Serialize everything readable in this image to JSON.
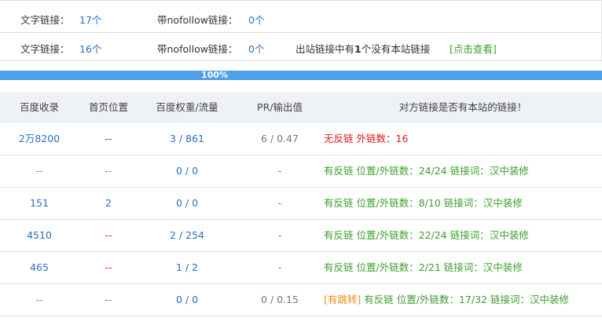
{
  "summary": {
    "row1": {
      "text_label": "文字链接：",
      "text_value": "17个",
      "nofollow_label": "带nofollow链接：",
      "nofollow_value": "0个"
    },
    "row2": {
      "text_label": "文字链接：",
      "text_value": "16个",
      "nofollow_label": "带nofollow链接：",
      "nofollow_value": "0个",
      "outbound_a": "出站链接中有",
      "outbound_num": "1",
      "outbound_b": "个没有本站链接",
      "check_link": "[点击查看]"
    }
  },
  "progress": {
    "label": "100%",
    "value": 1.0
  },
  "table": {
    "headers": [
      "百度收录",
      "首页位置",
      "百度权重/流量",
      "PR/输出值",
      "对方链接是否有本站的链接！"
    ],
    "rows": [
      {
        "baidu": "2万8200",
        "home": "--",
        "weight": "3 / 861",
        "pr": "6 / 0.47",
        "tag": "",
        "status": "无反链",
        "status_detail": "外链数：16",
        "keyword": ""
      },
      {
        "baidu": "--",
        "home": "--",
        "weight": "0 / 0",
        "pr": "-",
        "tag": "",
        "status": "有反链",
        "status_detail": "位置/外链数：24/24",
        "keyword": "链接词：汉中装修"
      },
      {
        "baidu": "151",
        "home": "2",
        "weight": "0 / 0",
        "pr": "-",
        "tag": "",
        "status": "有反链",
        "status_detail": "位置/外链数：8/10",
        "keyword": "链接词：汉中装修"
      },
      {
        "baidu": "4510",
        "home": "--",
        "weight": "2 / 254",
        "pr": "-",
        "tag": "",
        "status": "有反链",
        "status_detail": "位置/外链数：22/24",
        "keyword": "链接词：汉中装修"
      },
      {
        "baidu": "465",
        "home": "--",
        "weight": "1 / 2",
        "pr": "-",
        "tag": "",
        "status": "有反链",
        "status_detail": "位置/外链数：2/21",
        "keyword": "链接词：汉中装修"
      },
      {
        "baidu": "--",
        "home": "--",
        "weight": "0 / 0",
        "pr": "0 / 0.15",
        "tag": "[有跳转]",
        "status": "有反链",
        "status_detail": "位置/外链数：17/32",
        "keyword": "链接词：汉中装修"
      }
    ]
  }
}
